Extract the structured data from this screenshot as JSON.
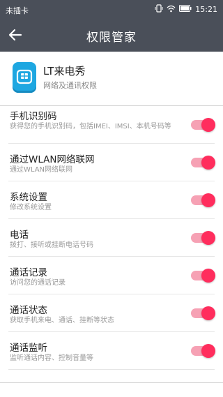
{
  "status_bar": {
    "carrier": "未插卡",
    "time": "15:21",
    "icons": [
      "vibrate-icon",
      "wifi-icon",
      "battery-icon"
    ]
  },
  "title_bar": {
    "title": "权限管家",
    "back_icon": "arrow-left-icon"
  },
  "app": {
    "name": "LT来电秀",
    "subtitle": "网络及通讯权限",
    "icon": "app-icon"
  },
  "permissions": [
    {
      "title": "手机识别码",
      "desc": "获得您的手机识别码，包括IMEI、IMSI、本机号码等",
      "enabled": true
    },
    {
      "title": "通过WLAN网络联网",
      "desc": "通过WLAN网络联网",
      "enabled": true
    },
    {
      "title": "系统设置",
      "desc": "修改系统设置",
      "enabled": true
    },
    {
      "title": "电话",
      "desc": "拨打、接听或挂断电话号码",
      "enabled": true
    },
    {
      "title": "通话记录",
      "desc": "访问您的通话记录",
      "enabled": true
    },
    {
      "title": "通话状态",
      "desc": "获取手机来电、通话、挂断等状态",
      "enabled": true
    },
    {
      "title": "通话监听",
      "desc": "监听通话内容、控制音量等",
      "enabled": true
    }
  ],
  "colors": {
    "header_bg": "#4a4f59",
    "toggle_on": "#ff2d5d",
    "toggle_track": "#f6a1b4"
  }
}
